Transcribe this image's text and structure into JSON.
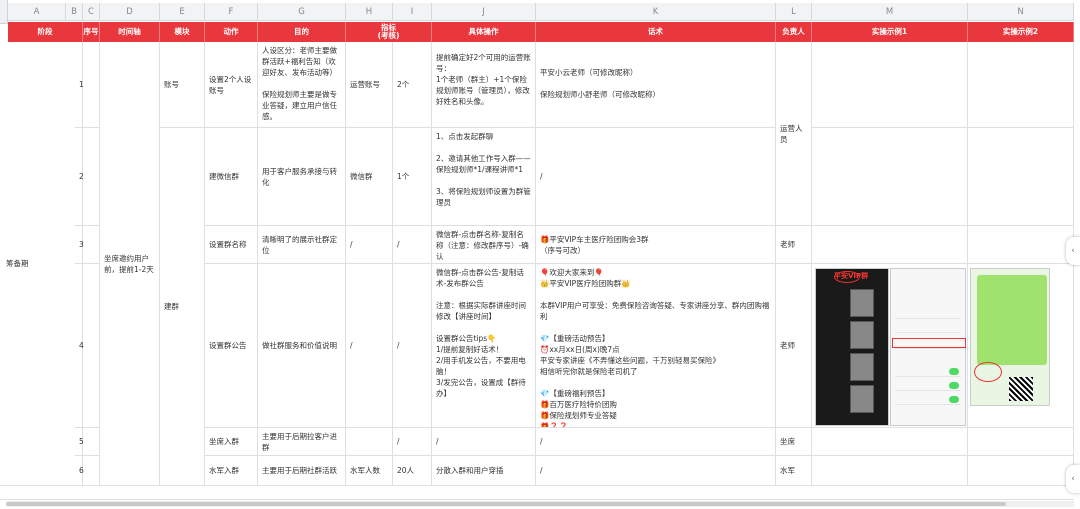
{
  "columns": [
    "A",
    "B",
    "C",
    "D",
    "E",
    "F",
    "G",
    "H",
    "I",
    "J",
    "K",
    "L",
    "M",
    "N"
  ],
  "headers": {
    "stage": "阶段",
    "seq": "序号",
    "timeline": "时间轴",
    "module": "模块",
    "action": "动作",
    "goal": "目的",
    "metric": "指标\n(考核)",
    "operation": "具体操作",
    "script": "话术",
    "owner": "负责人",
    "example1": "实操示例1",
    "example2": "实操示例2"
  },
  "stage": "筹备期",
  "timeline": "坐席邀约用户前，提前1-2天",
  "modules": {
    "account": "账号",
    "group": "建群"
  },
  "rows": [
    {
      "seq": "1",
      "action": "设置2个人设账号",
      "goal": "人设区分：老师主要做群活跃+福利告知（欢迎好友、发布活动等）\n\n保险规划师主要是做专业答疑，建立用户信任感。",
      "metric": "运营账号",
      "count": "2个",
      "operation": "提前确定好2个可用的运营账号：\n1个老师（群主）+1个保险规划师账号（管理员），修改好姓名和头像。",
      "script": "平安小云老师（可修改昵称）\n\n保险规划师小舒老师（可修改昵称）",
      "owner": ""
    },
    {
      "seq": "2",
      "action": "建微信群",
      "goal": "用于客户服务承接与转化",
      "metric": "微信群",
      "count": "1个",
      "operation": "1、点击发起群聊\n\n2、邀请其他工作号入群——\n保险规划师*1/课程讲师*1\n\n3、将保险规划师设置为群管理员",
      "script": "/",
      "owner": "运营人员"
    },
    {
      "seq": "3",
      "action": "设置群名称",
      "goal": "清晰明了的展示社群定位",
      "metric": "/",
      "count": "/",
      "operation": "微信群-点击群名称-复制名称（注意：修改群序号）-确认",
      "script": "🎁平安VIP车主医疗险团购会3群\n（序号可改）",
      "owner": "老师"
    },
    {
      "seq": "4",
      "action": "设置群公告",
      "goal": "做社群服务和价值说明",
      "metric": "/",
      "count": "/",
      "operation": "微信群-点击群公告-复制话术-发布群公告\n\n注意：根据实际群讲座时间修改【讲座时间】\n\n设置群公告tips👇\n1/提前复制好话术！\n2/用手机发公告，不要用电脑！\n3/发完公告，设置成【群待办】",
      "script": "🎈欢迎大家来到🎈\n👑平安VIP医疗险团购群👑\n\n本群VIP用户可享受：免费保险咨询答疑、专家讲座分享、群内团购福利\n\n💎【重磅活动预告】\n⏰xx月xx日(周x)晚7点\n平安专家讲座《不弄懂这些问题，千万别轻易买保险》\n相信听完你就是保险老司机了\n\n💎【重磅福利预告】\n🎁百万医疗险特价团购\n🎁保险规划师专业答疑\n🎁❓❓",
      "owner": "老师"
    },
    {
      "seq": "5",
      "action": "坐席入群",
      "goal": "主要用于后期拉客户进群",
      "metric": "",
      "count": "/",
      "operation": "/",
      "script": "/",
      "owner": "坐席"
    },
    {
      "seq": "6",
      "action": "水军入群",
      "goal": "主要用于后期社群活跃",
      "metric": "水军人数",
      "count": "20人",
      "operation": "分散入群和用户穿插",
      "script": "/",
      "owner": "水军"
    }
  ],
  "example": {
    "chat_title": "平安VIP群"
  },
  "colors": {
    "header_bg": "#e8383d",
    "grid": "#dcdfe3"
  }
}
